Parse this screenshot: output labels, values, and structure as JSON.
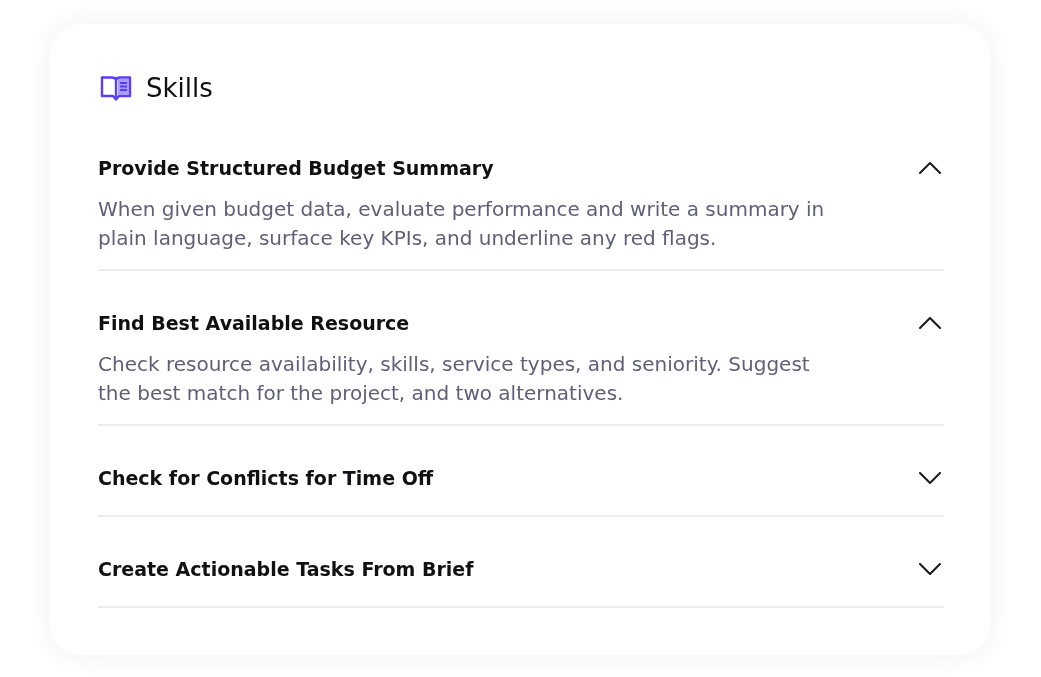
{
  "panel": {
    "title": "Skills"
  },
  "skills": [
    {
      "title": "Provide Structured Budget Summary",
      "expanded": true,
      "description": "When given budget data, evaluate performance and write a summary in plain language, surface key KPIs, and underline any red flags."
    },
    {
      "title": "Find Best Available Resource",
      "expanded": true,
      "description": "Check resource availability, skills, service types, and seniority. Suggest the best match for the project, and two alternatives."
    },
    {
      "title": "Check for Conflicts for Time Off",
      "expanded": false
    },
    {
      "title": "Create Actionable Tasks From Brief",
      "expanded": false
    }
  ]
}
